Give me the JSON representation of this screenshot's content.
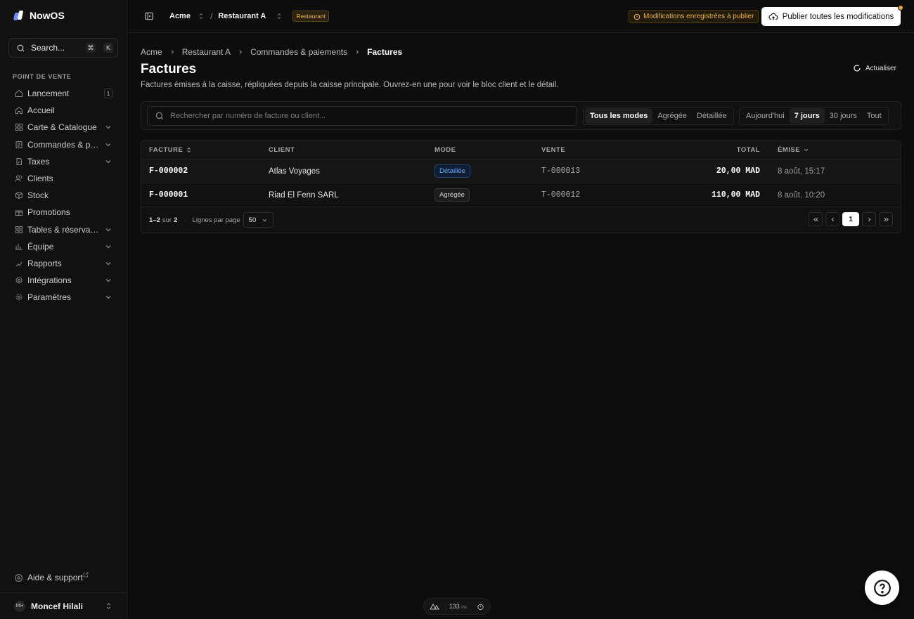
{
  "app": {
    "name": "NowOS"
  },
  "sidebar": {
    "search_label": "Search...",
    "search_keys": [
      "⌘",
      "K"
    ],
    "section_label": "POINT DE VENTE",
    "items": [
      {
        "label": "Lancement",
        "icon": "rocket-icon",
        "badge": "1"
      },
      {
        "label": "Accueil",
        "icon": "home-icon"
      },
      {
        "label": "Carte & Catalogue",
        "icon": "grid-icon",
        "expandable": true
      },
      {
        "label": "Commandes & pai...",
        "icon": "receipt-icon",
        "expandable": true
      },
      {
        "label": "Taxes",
        "icon": "document-icon",
        "expandable": true
      },
      {
        "label": "Clients",
        "icon": "users-icon"
      },
      {
        "label": "Stock",
        "icon": "box-icon"
      },
      {
        "label": "Promotions",
        "icon": "gift-icon"
      },
      {
        "label": "Tables & réservati...",
        "icon": "table-icon",
        "expandable": true
      },
      {
        "label": "Équipe",
        "icon": "team-icon",
        "expandable": true
      },
      {
        "label": "Rapports",
        "icon": "chart-icon",
        "expandable": true
      },
      {
        "label": "Intégrations",
        "icon": "plug-icon",
        "expandable": true
      },
      {
        "label": "Paramètres",
        "icon": "gear-icon",
        "expandable": true
      }
    ],
    "help_label": "Aide & support",
    "user": {
      "initials": "MH",
      "name": "Moncef Hilali"
    }
  },
  "topbar": {
    "org": "Acme",
    "separator": "/",
    "site": "Restaurant A",
    "site_badge": "Restaurant",
    "pending_text": "Modifications enregistrées à publier",
    "publish_label": "Publier toutes les modifications"
  },
  "breadcrumb": [
    "Acme",
    "Restaurant A",
    "Commandes & paiements",
    "Factures"
  ],
  "page": {
    "title": "Factures",
    "subtitle": "Factures émises à la caisse, répliquées depuis la caisse principale. Ouvrez-en une pour voir le bloc client et le détail.",
    "refresh_label": "Actualiser"
  },
  "filters": {
    "search_placeholder": "Rechercher par numéro de facture ou client...",
    "modes": [
      {
        "label": "Tous les modes",
        "active": true
      },
      {
        "label": "Agrégée",
        "active": false
      },
      {
        "label": "Détaillée",
        "active": false
      }
    ],
    "periods": [
      {
        "label": "Aujourd'hui",
        "active": false
      },
      {
        "label": "7 jours",
        "active": true
      },
      {
        "label": "30 jours",
        "active": false
      },
      {
        "label": "Tout",
        "active": false
      }
    ]
  },
  "table": {
    "columns": {
      "facture": "FACTURE",
      "client": "CLIENT",
      "mode": "MODE",
      "vente": "VENTE",
      "total": "TOTAL",
      "emise": "ÉMISE"
    },
    "rows": [
      {
        "facture": "F-000002",
        "client": "Atlas Voyages",
        "mode": "Détaillée",
        "mode_kind": "det",
        "vente": "T-000013",
        "total": "20,00 MAD",
        "emise": "8 août, 15:17"
      },
      {
        "facture": "F-000001",
        "client": "Riad El Fenn SARL",
        "mode": "Agrégée",
        "mode_kind": "agg",
        "vente": "T-000012",
        "total": "110,00 MAD",
        "emise": "8 août, 10:20"
      }
    ],
    "footer": {
      "range": "1–2",
      "of_label": "sur",
      "total": "2",
      "rows_per_page_label": "Lignes par page",
      "rows_per_page": "50",
      "current_page": "1"
    }
  },
  "status": {
    "latency": "133",
    "latency_unit": "ms"
  },
  "colors": {
    "accent_warning": "#e6b54a",
    "detailed_pill": "#6aa3e8",
    "background": "#0d0d0d"
  }
}
